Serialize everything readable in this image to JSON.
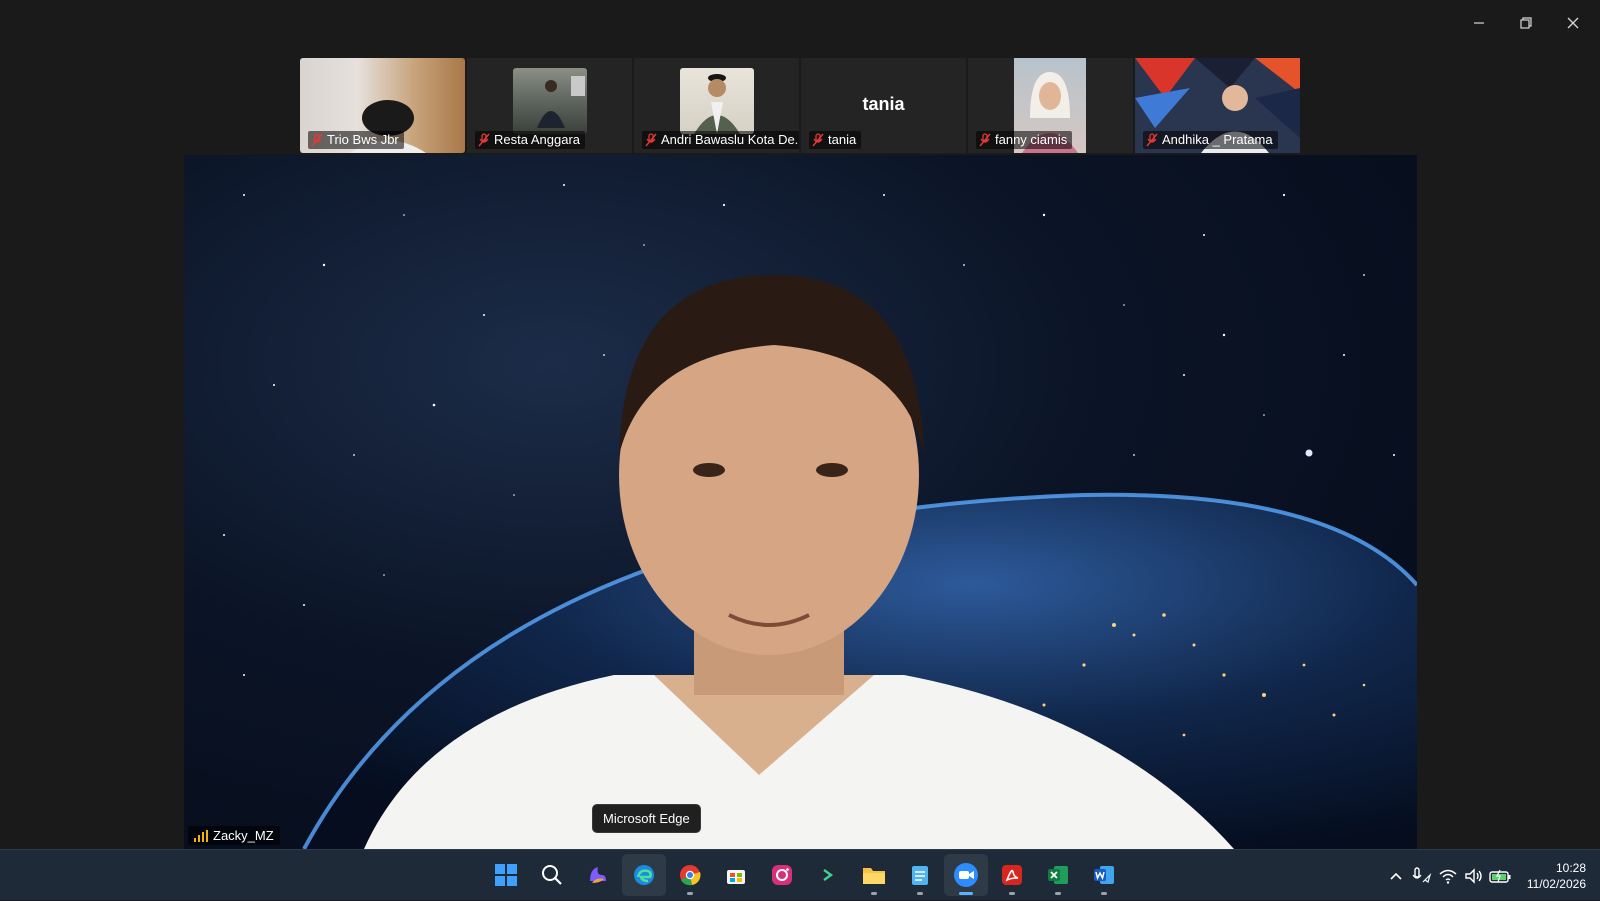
{
  "window": {
    "controls": [
      "minimize",
      "restore",
      "close"
    ]
  },
  "participants": [
    {
      "name": "Trio Bws Jbr",
      "muted": true,
      "icon": "mic-muted-icon"
    },
    {
      "name": "Resta Anggara",
      "muted": true,
      "icon": "mic-muted-icon"
    },
    {
      "name": "Andri Bawaslu Kota De...",
      "muted": true,
      "icon": "mic-muted-icon"
    },
    {
      "name": "tania",
      "display_name": "tania",
      "muted": true,
      "icon": "mic-muted-icon"
    },
    {
      "name": "fanny ciamis",
      "muted": true,
      "icon": "mic-muted-icon"
    },
    {
      "name": "Andhika _ Pratama",
      "muted": true,
      "icon": "mic-muted-icon"
    }
  ],
  "active_speaker": {
    "name": "Zacky_MZ",
    "icon": "signal-bars-icon"
  },
  "tooltip": "Microsoft Edge",
  "taskbar": {
    "apps": [
      "windows-start",
      "search",
      "copilot",
      "edge",
      "chrome",
      "microsoft-store",
      "instagram",
      "git-app",
      "file-explorer",
      "notepad",
      "zoom",
      "acrobat",
      "excel",
      "word"
    ],
    "active_app": "zoom"
  },
  "tray": {
    "time": "10:28",
    "date": "11/02/2026"
  },
  "colors": {
    "background": "#1a1a1a",
    "taskbar": "#1e2a38",
    "muted_mic": "#e53935"
  }
}
